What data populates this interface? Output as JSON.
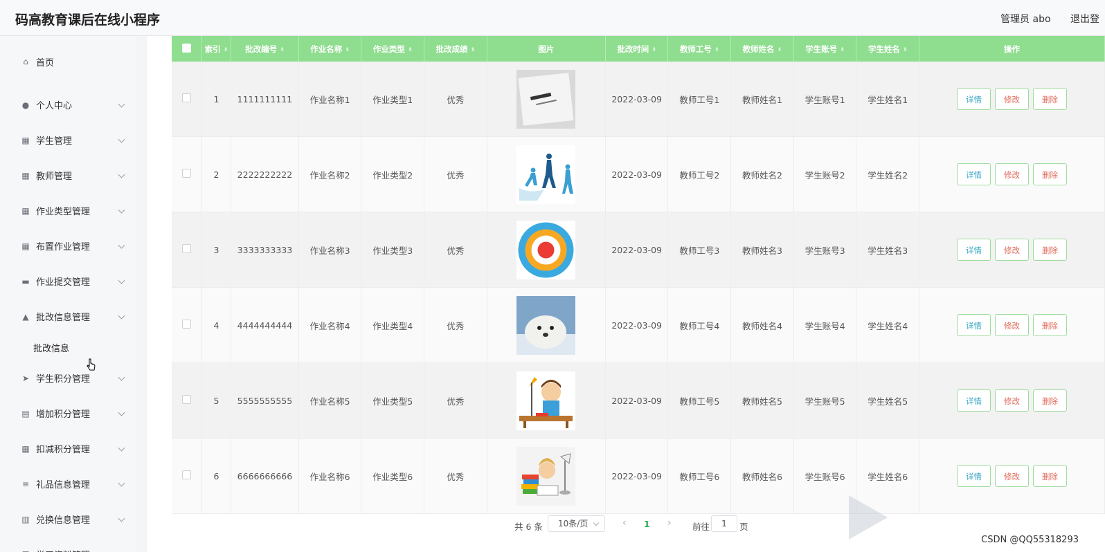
{
  "app": {
    "title": "码高教育课后在线小程序"
  },
  "topbar": {
    "user": "管理员 abo",
    "logout": "退出登"
  },
  "sidebar": {
    "items": [
      {
        "label": "首页",
        "icon": "home-icon",
        "glyph": "⌂",
        "has_children": false
      },
      {
        "label": "个人中心",
        "icon": "user-icon",
        "glyph": "●",
        "has_children": true
      },
      {
        "label": "学生管理",
        "icon": "grid-icon",
        "glyph": "▦",
        "has_children": true
      },
      {
        "label": "教师管理",
        "icon": "grid-icon",
        "glyph": "▦",
        "has_children": true
      },
      {
        "label": "作业类型管理",
        "icon": "grid-icon",
        "glyph": "▦",
        "has_children": true
      },
      {
        "label": "布置作业管理",
        "icon": "grid-icon",
        "glyph": "▦",
        "has_children": true
      },
      {
        "label": "作业提交管理",
        "icon": "tray-icon",
        "glyph": "▬",
        "has_children": true
      },
      {
        "label": "批改信息管理",
        "icon": "person-icon",
        "glyph": "▲",
        "has_children": true,
        "expanded": true,
        "children": [
          {
            "label": "批改信息"
          }
        ]
      },
      {
        "label": "学生积分管理",
        "icon": "send-icon",
        "glyph": "➤",
        "has_children": true
      },
      {
        "label": "增加积分管理",
        "icon": "message-icon",
        "glyph": "▤",
        "has_children": true
      },
      {
        "label": "扣减积分管理",
        "icon": "grid-icon",
        "glyph": "▦",
        "has_children": true
      },
      {
        "label": "礼品信息管理",
        "icon": "sliders-icon",
        "glyph": "≡",
        "has_children": true
      },
      {
        "label": "兑换信息管理",
        "icon": "chart-icon",
        "glyph": "▥",
        "has_children": true
      },
      {
        "label": "学习资料管理",
        "icon": "list-icon",
        "glyph": "☰",
        "has_children": true
      }
    ]
  },
  "table": {
    "headers": [
      "索引",
      "批改编号",
      "作业名称",
      "作业类型",
      "批改成绩",
      "图片",
      "批改时间",
      "教师工号",
      "教师姓名",
      "学生账号",
      "学生姓名",
      "操作"
    ],
    "rows": [
      {
        "index": "1",
        "code": "1111111111",
        "name": "作业名称1",
        "type": "作业类型1",
        "grade": "优秀",
        "image": "paper-note",
        "time": "2022-03-09",
        "tno": "教师工号1",
        "tname": "教师姓名1",
        "sacc": "学生账号1",
        "sname": "学生姓名1"
      },
      {
        "index": "2",
        "code": "2222222222",
        "name": "作业名称2",
        "type": "作业类型2",
        "grade": "优秀",
        "image": "sports-silhouettes",
        "time": "2022-03-09",
        "tno": "教师工号2",
        "tname": "教师姓名2",
        "sacc": "学生账号2",
        "sname": "学生姓名2"
      },
      {
        "index": "3",
        "code": "3333333333",
        "name": "作业名称3",
        "type": "作业类型3",
        "grade": "优秀",
        "image": "ring-diagram",
        "time": "2022-03-09",
        "tno": "教师工号3",
        "tname": "教师姓名3",
        "sacc": "学生账号3",
        "sname": "学生姓名3"
      },
      {
        "index": "4",
        "code": "4444444444",
        "name": "作业名称4",
        "type": "作业类型4",
        "grade": "优秀",
        "image": "seal-photo",
        "time": "2022-03-09",
        "tno": "教师工号4",
        "tname": "教师姓名4",
        "sacc": "学生账号4",
        "sname": "学生姓名4"
      },
      {
        "index": "5",
        "code": "5555555555",
        "name": "作业名称5",
        "type": "作业类型5",
        "grade": "优秀",
        "image": "student-desk",
        "time": "2022-03-09",
        "tno": "教师工号5",
        "tname": "教师姓名5",
        "sacc": "学生账号5",
        "sname": "学生姓名5"
      },
      {
        "index": "6",
        "code": "6666666666",
        "name": "作业名称6",
        "type": "作业类型6",
        "grade": "优秀",
        "image": "student-books",
        "time": "2022-03-09",
        "tno": "教师工号6",
        "tname": "教师姓名6",
        "sacc": "学生账号6",
        "sname": "学生姓名6"
      }
    ],
    "actions": {
      "detail": "详情",
      "edit": "修改",
      "delete": "删除"
    }
  },
  "pagination": {
    "total": "共 6 条",
    "page_size": "10条/页",
    "prev": "‹",
    "current": "1",
    "next": "›",
    "goto": "前往",
    "goto_value": "1",
    "page_unit": "页"
  },
  "watermark": {
    "text": "CSDN @QQ55318293"
  },
  "colors": {
    "header_green": "#8fdd8f",
    "accent_green": "#2ea84f",
    "detail_blue": "#3aa8c4",
    "danger_red": "#e06a5a"
  }
}
